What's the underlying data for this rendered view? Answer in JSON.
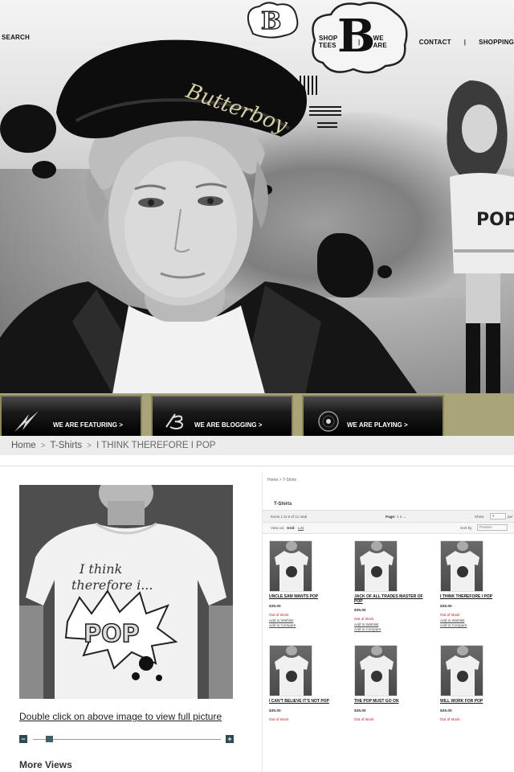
{
  "nav": {
    "search_label": "SEARCH",
    "items": [
      "SHOP TEES",
      "WE ARE",
      "CONTACT",
      "SHOPPING"
    ],
    "separator": "|"
  },
  "hero": {
    "cap_text": "Butterboy",
    "logo_letter": "B",
    "shirt_text": "POP"
  },
  "features": [
    {
      "label": "WE ARE FEATURING >",
      "icon": "lightning-slash-icon"
    },
    {
      "label": "WE ARE BLOGGING >",
      "icon": "b-logo-icon"
    },
    {
      "label": "WE ARE PLAYING >",
      "icon": "vinyl-record-icon"
    }
  ],
  "breadcrumb": {
    "home": "Home",
    "category": "T-Shirts",
    "current": "I THINK THEREFORE I POP",
    "separator": ">"
  },
  "product": {
    "shirt_line1": "I think",
    "shirt_line2": "therefore i...",
    "shirt_pop": "POP",
    "dblclick_text": "Double click on above image to view full picture",
    "zoom_minus": "−",
    "zoom_plus": "+",
    "zoom_level": 0.07,
    "more_views": "More Views"
  },
  "catalog": {
    "breadcrumb": "Home > T-Shirts",
    "title": "T-Shirts",
    "items_info": "Items 1 to 9 of 11 total",
    "page_label": "Page:",
    "pages": "1 2 →",
    "show_label": "Show",
    "show_value": "9",
    "per_page": "per",
    "view_as": "View as:",
    "view_grid": "Grid",
    "view_list": "List",
    "sort_label": "Sort by",
    "sort_value": "Position",
    "products": [
      {
        "name": "UNCLE SAM WANTS POP",
        "price": "$35.00",
        "stock": "Out of stock",
        "wishlist": "Add to Wishlist",
        "compare": "Add to Compare"
      },
      {
        "name": "JACK OF ALL TRADES MASTER OF POP",
        "price": "$35.00",
        "stock": "Out of stock",
        "wishlist": "Add to Wishlist",
        "compare": "Add to Compare"
      },
      {
        "name": "I THINK THEREFORE I POP",
        "price": "$35.00",
        "stock": "Out of stock",
        "wishlist": "Add to Wishlist",
        "compare": "Add to Compare"
      },
      {
        "name": "I CAN'T BELIEVE IT'S NOT POP",
        "price": "$35.00",
        "stock": "Out of stock"
      },
      {
        "name": "THE POP MUST GO ON",
        "price": "$35.00",
        "stock": "Out of stock"
      },
      {
        "name": "WILL WORK FOR POP",
        "price": "$35.00",
        "stock": "Out of stock"
      }
    ]
  },
  "colors": {
    "accent_olive": "#a9a47a",
    "stock_red": "#c0121b",
    "zoom_button": "#2e4a52"
  }
}
